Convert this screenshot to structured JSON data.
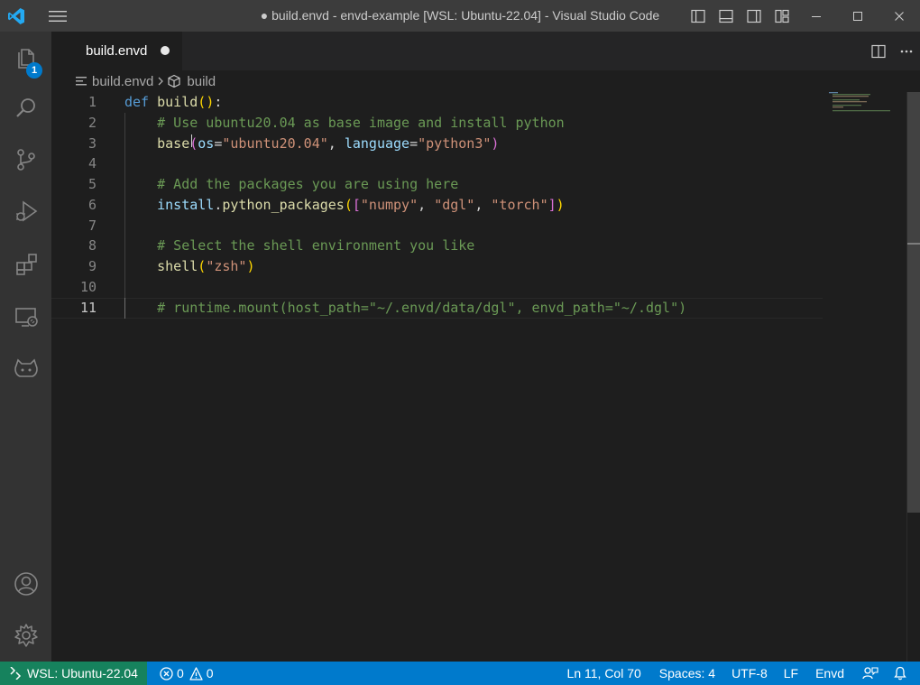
{
  "window": {
    "title": "● build.envd - envd-example [WSL: Ubuntu-22.04] - Visual Studio Code"
  },
  "activity_bar": {
    "explorer_badge": "1",
    "items": [
      "explorer",
      "search",
      "source-control",
      "run-and-debug",
      "extensions",
      "remote-explorer",
      "github"
    ],
    "bottom_items": [
      "accounts",
      "manage"
    ]
  },
  "tabs": [
    {
      "label": "build.envd",
      "dirty": true,
      "active": true
    }
  ],
  "breadcrumb": {
    "file": "build.envd",
    "symbol": "build"
  },
  "editor": {
    "language": "envd",
    "active_line": 11,
    "line_numbers": [
      "1",
      "2",
      "3",
      "4",
      "5",
      "6",
      "7",
      "8",
      "9",
      "10",
      "11"
    ],
    "lines": [
      [
        {
          "t": "def",
          "c": "kw"
        },
        {
          "t": " ",
          "c": ""
        },
        {
          "t": "build",
          "c": "fn"
        },
        {
          "t": "(",
          "c": "paren"
        },
        {
          "t": ")",
          "c": "paren"
        },
        {
          "t": ":",
          "c": ""
        }
      ],
      [
        {
          "t": "    ",
          "c": ""
        },
        {
          "t": "# Use ubuntu20.04 as base image and install python",
          "c": "cm"
        }
      ],
      [
        {
          "t": "    ",
          "c": ""
        },
        {
          "t": "base",
          "c": "fn"
        },
        {
          "t": "(",
          "c": "brk"
        },
        {
          "t": "os",
          "c": "var"
        },
        {
          "t": "=",
          "c": ""
        },
        {
          "t": "\"ubuntu20.04\"",
          "c": "str"
        },
        {
          "t": ", ",
          "c": ""
        },
        {
          "t": "language",
          "c": "var"
        },
        {
          "t": "=",
          "c": ""
        },
        {
          "t": "\"python3\"",
          "c": "str"
        },
        {
          "t": ")",
          "c": "brk"
        }
      ],
      [],
      [
        {
          "t": "    ",
          "c": ""
        },
        {
          "t": "# Add the packages you are using here",
          "c": "cm"
        }
      ],
      [
        {
          "t": "    ",
          "c": ""
        },
        {
          "t": "install",
          "c": "var"
        },
        {
          "t": ".",
          "c": ""
        },
        {
          "t": "python_packages",
          "c": "fn"
        },
        {
          "t": "(",
          "c": "paren"
        },
        {
          "t": "[",
          "c": "brk"
        },
        {
          "t": "\"numpy\"",
          "c": "str"
        },
        {
          "t": ", ",
          "c": ""
        },
        {
          "t": "\"dgl\"",
          "c": "str"
        },
        {
          "t": ", ",
          "c": ""
        },
        {
          "t": "\"torch\"",
          "c": "str"
        },
        {
          "t": "]",
          "c": "brk"
        },
        {
          "t": ")",
          "c": "paren"
        }
      ],
      [],
      [
        {
          "t": "    ",
          "c": ""
        },
        {
          "t": "# Select the shell environment you like",
          "c": "cm"
        }
      ],
      [
        {
          "t": "    ",
          "c": ""
        },
        {
          "t": "shell",
          "c": "fn"
        },
        {
          "t": "(",
          "c": "paren"
        },
        {
          "t": "\"zsh\"",
          "c": "str"
        },
        {
          "t": ")",
          "c": "paren"
        }
      ],
      [],
      [
        {
          "t": "    ",
          "c": ""
        },
        {
          "t": "# runtime.mount(host_path=\"~/.envd/data/dgl\", envd_path=\"~/.dgl\")",
          "c": "cm"
        }
      ]
    ]
  },
  "status_bar": {
    "remote": "WSL: Ubuntu-22.04",
    "errors": "0",
    "warnings": "0",
    "position": "Ln 11, Col 70",
    "indent": "Spaces: 4",
    "encoding": "UTF-8",
    "eol": "LF",
    "language": "Envd"
  },
  "colors": {
    "status_bar": "#007acc",
    "remote": "#16825d",
    "title_bar": "#3c3c3c",
    "activity_bar": "#333333",
    "editor": "#1e1e1e"
  }
}
